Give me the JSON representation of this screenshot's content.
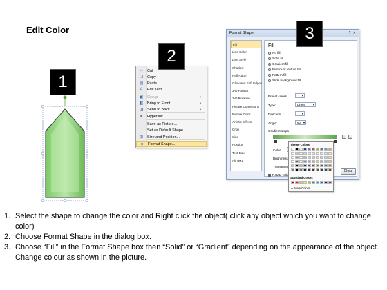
{
  "title": "Edit Color",
  "badges": [
    "1",
    "2",
    "3"
  ],
  "context_menu": {
    "items": [
      {
        "label": "Cut",
        "icon": "scissors-icon",
        "glyph": "✂",
        "disabled": false,
        "arrow": false
      },
      {
        "label": "Copy",
        "icon": "copy-icon",
        "glyph": "❐",
        "disabled": false,
        "arrow": false
      },
      {
        "label": "Paste",
        "icon": "paste-icon",
        "glyph": "▤",
        "disabled": false,
        "arrow": false
      },
      {
        "label": "Edit Text",
        "icon": "edit-text-icon",
        "glyph": "A",
        "disabled": false,
        "arrow": false
      },
      {
        "label": "Group",
        "icon": "group-icon",
        "glyph": "▣",
        "disabled": true,
        "arrow": true
      },
      {
        "label": "Bring to Front",
        "icon": "bring-front-icon",
        "glyph": "◧",
        "disabled": false,
        "arrow": true
      },
      {
        "label": "Send to Back",
        "icon": "send-back-icon",
        "glyph": "◨",
        "disabled": false,
        "arrow": true
      },
      {
        "label": "Hyperlink...",
        "icon": "hyperlink-icon",
        "glyph": "⚭",
        "disabled": false,
        "arrow": false
      },
      {
        "label": "Save as Picture...",
        "icon": "",
        "glyph": "",
        "disabled": false,
        "arrow": false
      },
      {
        "label": "Set as Default Shape",
        "icon": "",
        "glyph": "",
        "disabled": false,
        "arrow": false
      },
      {
        "label": "Size and Position...",
        "icon": "size-icon",
        "glyph": "⊞",
        "disabled": false,
        "arrow": false
      },
      {
        "label": "Format Shape...",
        "icon": "format-shape-icon",
        "glyph": "◈",
        "disabled": false,
        "arrow": false
      }
    ]
  },
  "dialog": {
    "title": "Format Shape",
    "window_controls": "? ✕",
    "categories": [
      "Fill",
      "Line Color",
      "Line Style",
      "Shadow",
      "Reflection",
      "Glow and Soft Edges",
      "3-D Format",
      "3-D Rotation",
      "Picture Corrections",
      "Picture Color",
      "Artistic Effects",
      "Crop",
      "Size",
      "Position",
      "Text Box",
      "Alt Text"
    ],
    "selected_category": "Fill",
    "panel_heading": "Fill",
    "fill_options": [
      "No fill",
      "Solid fill",
      "Gradient fill",
      "Picture or texture fill",
      "Pattern fill",
      "Slide background fill"
    ],
    "selected_fill": "Gradient fill",
    "preset_colors_label": "Preset colors:",
    "type_label": "Type:",
    "type_value": "Linear",
    "direction_label": "Direction:",
    "angle_label": "Angle:",
    "angle_value": "90°",
    "gradient_stops_label": "Gradient stops",
    "color_label": "Color",
    "position_label": "Position:",
    "position_value": "0%",
    "brightness_label": "Brightness",
    "transparency_label": "Transparency",
    "rotate_label": "Rotate with shape",
    "close_label": "Close"
  },
  "palette": {
    "theme_label": "Theme Colors",
    "standard_label": "Standard Colors",
    "more_label": "More Colors...",
    "theme_top": [
      "#ffffff",
      "#000000",
      "#eeece1",
      "#1f497d",
      "#4f81bd",
      "#c0504d",
      "#9bbb59",
      "#8064a2",
      "#4bacc6",
      "#f79646"
    ],
    "standard": [
      "#c00000",
      "#ff0000",
      "#ffc000",
      "#ffff00",
      "#92d050",
      "#00b050",
      "#00b0f0",
      "#0070c0",
      "#002060",
      "#7030a0"
    ]
  },
  "instructions": [
    {
      "num": "1.",
      "text": "Select the shape to change the color and Right click the object( click any object which you want to change color)"
    },
    {
      "num": "2.",
      "text": "Choose Format Shape in the dialog box."
    },
    {
      "num": "3.",
      "text": "Choose “Fill” in the Format Shape box then “Solid” or “Gradient” depending on the appearance of the object. Change colour as shown in the picture."
    }
  ]
}
